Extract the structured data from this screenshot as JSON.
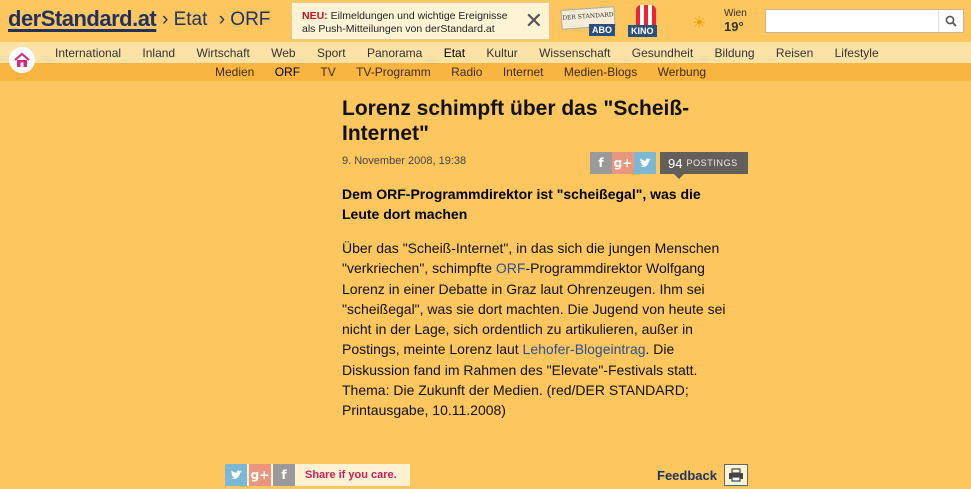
{
  "header": {
    "logo": "derStandard.at",
    "breadcrumb": [
      "› Etat",
      "› ORF"
    ],
    "push": {
      "new_label": "NEU:",
      "text": "Eilmeldungen und wichtige Ereignisse als Push-Mitteilungen von derStandard.at"
    },
    "abo_label": "ABO",
    "abo_paper": "DER STANDARD",
    "kino_label": "KINO",
    "weather": {
      "city": "Wien",
      "temp": "19°"
    },
    "search": {
      "value": "",
      "placeholder": ""
    }
  },
  "nav": {
    "primary": [
      "International",
      "Inland",
      "Wirtschaft",
      "Web",
      "Sport",
      "Panorama",
      "Etat",
      "Kultur",
      "Wissenschaft",
      "Gesundheit",
      "Bildung",
      "Reisen",
      "Lifestyle"
    ],
    "primary_active": "Etat",
    "secondary": [
      "Medien",
      "ORF",
      "TV",
      "TV-Programm",
      "Radio",
      "Internet",
      "Medien-Blogs",
      "Werbung"
    ],
    "secondary_active": "ORF"
  },
  "article": {
    "headline": "Lorenz schimpft über das \"Scheiß-Internet\"",
    "date": "9. November 2008, 19:38",
    "postings_count": "94",
    "postings_label": "POSTINGS",
    "lead": "Dem ORF-Programmdirektor ist \"scheißegal\", was die Leute dort machen",
    "body_1": "Über das \"Scheiß-Internet\", in das sich die jungen Menschen \"verkriechen\", schimpfte ",
    "body_link_1": "ORF",
    "body_2": "-Programmdirektor Wolfgang Lorenz in einer Debatte in Graz laut Ohrenzeugen. Ihm sei \"scheißegal\", was sie dort machten. Die Jugend von heute sei nicht in der Lage, sich ordentlich zu artikulieren, außer in Postings, meinte Lorenz laut ",
    "body_link_2": "Lehofer-Blogeintrag",
    "body_3": ". Die Diskussion fand im Rahmen des \"Elevate\"-Festivals statt. Thema: Die Zukunft der Medien.  (red/DER STANDARD; Printausgabe, 10.11.2008)"
  },
  "social_icons": {
    "facebook": "f",
    "googleplus": "g+"
  },
  "footer": {
    "share_label": "Share if you care.",
    "feedback_label": "Feedback"
  },
  "colors": {
    "background": "#fdc65f",
    "brand": "#24315f",
    "share_accent": "#c81f58"
  }
}
